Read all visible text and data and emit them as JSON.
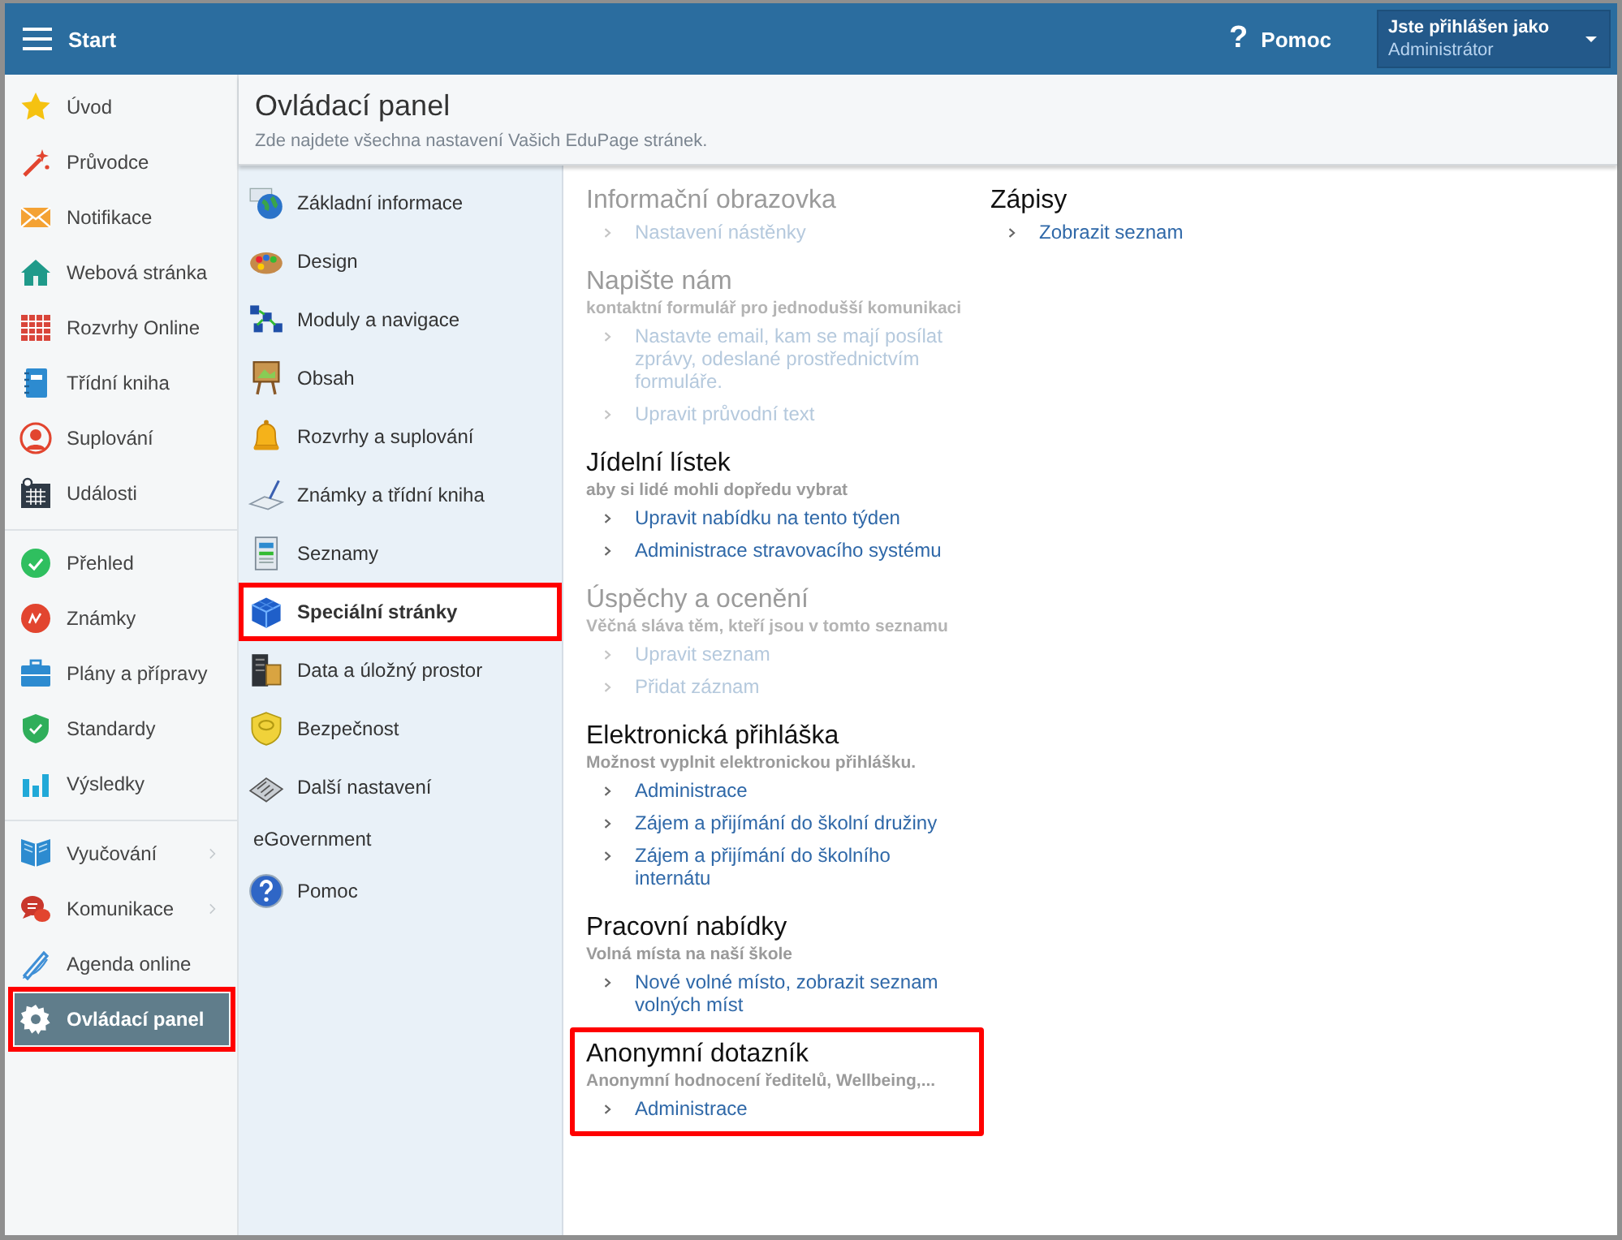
{
  "header": {
    "menu_title": "Start",
    "help_glyph": "?",
    "help": "Pomoc",
    "user_label": "Jste přihlášen jako",
    "user_name": "Administrátor"
  },
  "sidebar": {
    "groups": [
      {
        "items": [
          {
            "label": "Úvod",
            "selected": false,
            "highlighted": false,
            "has_submenu": false
          },
          {
            "label": "Průvodce",
            "selected": false,
            "highlighted": false,
            "has_submenu": false
          },
          {
            "label": "Notifikace",
            "selected": false,
            "highlighted": false,
            "has_submenu": false
          },
          {
            "label": "Webová stránka",
            "selected": false,
            "highlighted": false,
            "has_submenu": false
          },
          {
            "label": "Rozvrhy Online",
            "selected": false,
            "highlighted": false,
            "has_submenu": false
          },
          {
            "label": "Třídní kniha",
            "selected": false,
            "highlighted": false,
            "has_submenu": false
          },
          {
            "label": "Suplování",
            "selected": false,
            "highlighted": false,
            "has_submenu": false
          },
          {
            "label": "Události",
            "selected": false,
            "highlighted": false,
            "has_submenu": false
          }
        ]
      },
      {
        "items": [
          {
            "label": "Přehled",
            "selected": false,
            "highlighted": false,
            "has_submenu": false
          },
          {
            "label": "Známky",
            "selected": false,
            "highlighted": false,
            "has_submenu": false
          },
          {
            "label": "Plány a přípravy",
            "selected": false,
            "highlighted": false,
            "has_submenu": false
          },
          {
            "label": "Standardy",
            "selected": false,
            "highlighted": false,
            "has_submenu": false
          },
          {
            "label": "Výsledky",
            "selected": false,
            "highlighted": false,
            "has_submenu": false
          }
        ]
      },
      {
        "items": [
          {
            "label": "Vyučování",
            "selected": false,
            "highlighted": false,
            "has_submenu": true
          },
          {
            "label": "Komunikace",
            "selected": false,
            "highlighted": false,
            "has_submenu": true
          },
          {
            "label": "Agenda online",
            "selected": false,
            "highlighted": false,
            "has_submenu": false
          },
          {
            "label": "Ovládací panel",
            "selected": true,
            "highlighted": true,
            "has_submenu": false
          }
        ]
      }
    ]
  },
  "page": {
    "title": "Ovládací panel",
    "subtitle": "Zde najdete všechna nastavení Vašich EduPage stránek."
  },
  "settings_menu": {
    "items": [
      {
        "kind": "entry",
        "label": "Základní informace",
        "selected": false,
        "highlighted": false
      },
      {
        "kind": "entry",
        "label": "Design",
        "selected": false,
        "highlighted": false
      },
      {
        "kind": "entry",
        "label": "Moduly a navigace",
        "selected": false,
        "highlighted": false
      },
      {
        "kind": "entry",
        "label": "Obsah",
        "selected": false,
        "highlighted": false
      },
      {
        "kind": "entry",
        "label": "Rozvrhy a suplování",
        "selected": false,
        "highlighted": false
      },
      {
        "kind": "entry",
        "label": "Známky a třídní kniha",
        "selected": false,
        "highlighted": false
      },
      {
        "kind": "entry",
        "label": "Seznamy",
        "selected": false,
        "highlighted": false
      },
      {
        "kind": "entry",
        "label": "Speciální stránky",
        "selected": true,
        "highlighted": true
      },
      {
        "kind": "entry",
        "label": "Data a úložný prostor",
        "selected": false,
        "highlighted": false
      },
      {
        "kind": "entry",
        "label": "Bezpečnost",
        "selected": false,
        "highlighted": false
      },
      {
        "kind": "entry",
        "label": "Další nastavení",
        "selected": false,
        "highlighted": false
      },
      {
        "kind": "heading",
        "label": "eGovernment",
        "selected": false,
        "highlighted": false
      },
      {
        "kind": "entry",
        "label": "Pomoc",
        "selected": false,
        "highlighted": false
      }
    ]
  },
  "sections": {
    "columns": [
      [
        {
          "title": "Informační obrazovka",
          "disabled": true,
          "highlighted": false,
          "links": [
            "Nastavení nástěnky"
          ]
        },
        {
          "title": "Napište nám",
          "subtitle": "kontaktní formulář pro jednodušší komunikaci",
          "disabled": true,
          "highlighted": false,
          "links": [
            "Nastavte email, kam se mají posílat zprávy, odeslané prostřednictvím formuláře.",
            "Upravit průvodní text"
          ]
        },
        {
          "title": "Jídelní lístek",
          "subtitle": "aby si lidé mohli dopředu vybrat",
          "disabled": false,
          "highlighted": false,
          "links": [
            "Upravit nabídku na tento týden",
            "Administrace stravovacího systému"
          ]
        },
        {
          "title": "Úspěchy a ocenění",
          "subtitle": "Věčná sláva těm, kteří jsou v tomto seznamu",
          "disabled": true,
          "highlighted": false,
          "links": [
            "Upravit seznam",
            "Přidat záznam"
          ]
        },
        {
          "title": "Elektronická přihláška",
          "subtitle": "Možnost vyplnit elektronickou přihlášku.",
          "disabled": false,
          "highlighted": false,
          "links": [
            "Administrace",
            "Zájem a přijímání do školní družiny",
            "Zájem a přijímání do školního internátu"
          ]
        },
        {
          "title": "Pracovní nabídky",
          "subtitle": "Volná místa na naší škole",
          "disabled": false,
          "highlighted": false,
          "links": [
            "Nové volné místo, zobrazit seznam volných míst"
          ]
        },
        {
          "title": "Anonymní dotazník",
          "subtitle": "Anonymní hodnocení ředitelů, Wellbeing,...",
          "disabled": false,
          "highlighted": true,
          "links": [
            "Administrace"
          ]
        }
      ],
      [
        {
          "title": "Zápisy",
          "disabled": false,
          "highlighted": false,
          "links": [
            "Zobrazit seznam"
          ]
        }
      ]
    ]
  }
}
